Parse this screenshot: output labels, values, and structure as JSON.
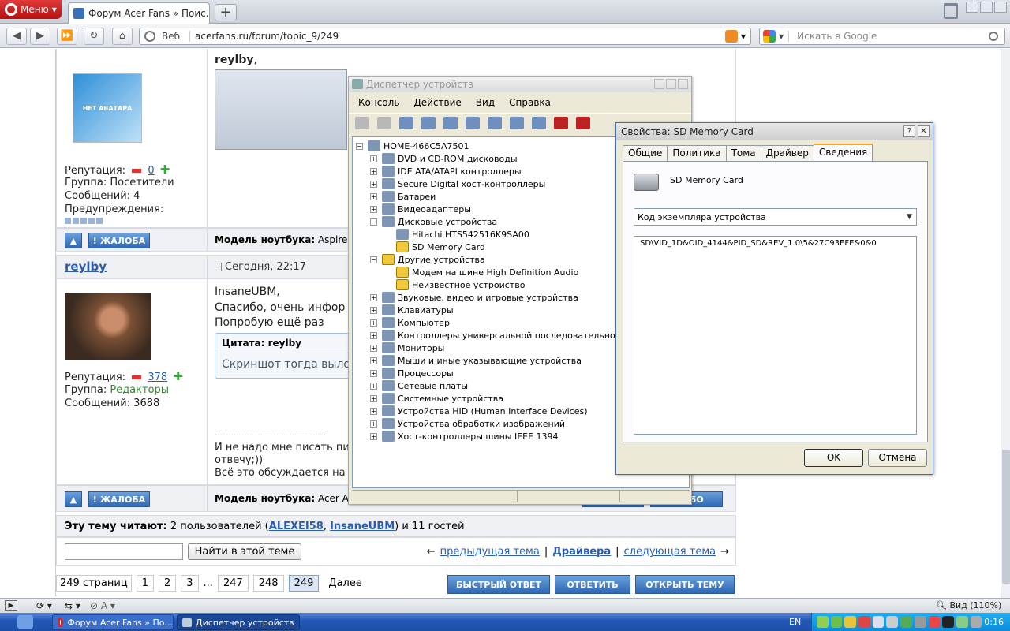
{
  "browser": {
    "menu_label": "Меню",
    "tab_title": "Форум Acer Fans » Поис...",
    "tab_close": "✕",
    "newtab": "+",
    "address_label": "Веб",
    "url": "acerfans.ru/forum/topic_9/249",
    "search_placeholder": "Искать в Google"
  },
  "forum": {
    "post1": {
      "avatar_text": "НЕТ АВАТАРА",
      "greeting": "reylby",
      "greeting_suffix": ",",
      "reputation_label": "Репутация:",
      "reputation_value": "0",
      "group_label": "Группа:",
      "group_value": "Посетители",
      "messages_label": "Сообщений:",
      "messages_value": "4",
      "warnings_label": "Предупреждения:",
      "complaint": "ЖАЛОБА",
      "model_label": "Модель ноутбука:",
      "model_value": "Aspire"
    },
    "post2": {
      "author": "reylby",
      "date": "Сегодня, 22:17",
      "greeting": "InsaneUBM",
      "greeting_suffix": ",",
      "line1": "Спасибо, очень инфор",
      "line2": "Попробую ещё раз",
      "quote_title": "Цитата: reylby",
      "quote_text": "Скриншот тогда выло",
      "reputation_label": "Репутация:",
      "reputation_value": "378",
      "group_label": "Группа:",
      "group_value": "Редакторы",
      "messages_label": "Сообщений:",
      "messages_value": "3688",
      "dashes": "------------------------------------------",
      "sig1": "И не надо мне писать пи",
      "sig2": "отвечу;))",
      "sig3": "Всё это обсуждается на",
      "complaint": "ЖАЛОБА",
      "model_label": "Модель ноутбука:",
      "model_value": "Acer A",
      "thanks_btn": "АСИБО"
    },
    "readers": {
      "label": "Эту тему читают:",
      "text1": "2 пользователей (",
      "user1": "ALEXEI58",
      "sep": ", ",
      "user2": "InsaneUBM",
      "text2": ") и 11 гостей"
    },
    "find_button": "Найти в этой теме",
    "nav": {
      "prev_arrow": "←",
      "prev": "предыдущая тема",
      "bar1": "|",
      "drivers": "Драйвера",
      "bar2": "|",
      "next": "следующая тема",
      "next_arrow": "→"
    },
    "pagination": {
      "total": "249 страниц",
      "pages": [
        "1",
        "2",
        "3",
        "...",
        "247",
        "248",
        "249"
      ],
      "next": "Далее"
    },
    "actions": {
      "quick": "БЫСТРЫЙ ОТВЕТ",
      "reply": "ОТВЕТИТЬ",
      "open": "ОТКРЫТЬ ТЕМУ"
    }
  },
  "device_manager": {
    "title": "Диспетчер устройств",
    "menu": [
      "Консоль",
      "Действие",
      "Вид",
      "Справка"
    ],
    "root": "HOME-466C5A7501",
    "tree": [
      {
        "label": "DVD и CD-ROM дисководы",
        "expander": "+",
        "level": 1,
        "icon": "disc-drive-icon"
      },
      {
        "label": "IDE ATA/ATAPI контроллеры",
        "expander": "+",
        "level": 1,
        "icon": "ide-controller-icon"
      },
      {
        "label": "Secure Digital хост-контроллеры",
        "expander": "+",
        "level": 1,
        "icon": "sd-controller-icon"
      },
      {
        "label": "Батареи",
        "expander": "+",
        "level": 1,
        "icon": "battery-icon"
      },
      {
        "label": "Видеоадаптеры",
        "expander": "+",
        "level": 1,
        "icon": "display-adapter-icon"
      },
      {
        "label": "Дисковые устройства",
        "expander": "−",
        "level": 1,
        "icon": "disk-drive-icon"
      },
      {
        "label": "Hitachi HTS542516K9SA00",
        "expander": "",
        "level": 2,
        "icon": "disk-drive-icon"
      },
      {
        "label": "SD Memory Card",
        "expander": "",
        "level": 2,
        "icon": "warning-icon"
      },
      {
        "label": "Другие устройства",
        "expander": "−",
        "level": 1,
        "icon": "unknown-device-icon"
      },
      {
        "label": "Модем на шине High Definition Audio",
        "expander": "",
        "level": 2,
        "icon": "warning-icon"
      },
      {
        "label": "Неизвестное устройство",
        "expander": "",
        "level": 2,
        "icon": "warning-icon"
      },
      {
        "label": "Звуковые, видео и игровые устройства",
        "expander": "+",
        "level": 1,
        "icon": "sound-icon"
      },
      {
        "label": "Клавиатуры",
        "expander": "+",
        "level": 1,
        "icon": "keyboard-icon"
      },
      {
        "label": "Компьютер",
        "expander": "+",
        "level": 1,
        "icon": "computer-icon"
      },
      {
        "label": "Контроллеры универсальной последовательной шины",
        "expander": "+",
        "level": 1,
        "icon": "usb-icon"
      },
      {
        "label": "Мониторы",
        "expander": "+",
        "level": 1,
        "icon": "monitor-icon"
      },
      {
        "label": "Мыши и иные указывающие устройства",
        "expander": "+",
        "level": 1,
        "icon": "mouse-icon"
      },
      {
        "label": "Процессоры",
        "expander": "+",
        "level": 1,
        "icon": "processor-icon"
      },
      {
        "label": "Сетевые платы",
        "expander": "+",
        "level": 1,
        "icon": "network-card-icon"
      },
      {
        "label": "Системные устройства",
        "expander": "+",
        "level": 1,
        "icon": "system-device-icon"
      },
      {
        "label": "Устройства HID (Human Interface Devices)",
        "expander": "+",
        "level": 1,
        "icon": "hid-icon"
      },
      {
        "label": "Устройства обработки изображений",
        "expander": "+",
        "level": 1,
        "icon": "imaging-device-icon"
      },
      {
        "label": "Хост-контроллеры шины IEEE 1394",
        "expander": "+",
        "level": 1,
        "icon": "ieee1394-icon"
      }
    ]
  },
  "properties": {
    "title": "Свойства: SD Memory Card",
    "help": "?",
    "close": "✕",
    "tabs": [
      "Общие",
      "Политика",
      "Тома",
      "Драйвер",
      "Сведения"
    ],
    "device_name": "SD Memory Card",
    "select_value": "Код экземпляра устройства",
    "select_arrow": "▼",
    "value": "SD\\VID_1D&OID_4144&PID_SD&REV_1.0\\5&27C93EFE&0&0",
    "ok": "OK",
    "cancel": "Отмена"
  },
  "statusbar": {
    "zoom": "Вид (110%)"
  },
  "taskbar": {
    "tasks": [
      "Форум Acer Fans » По...",
      "Диспетчер устройств"
    ],
    "lang": "EN",
    "time": "0:16"
  }
}
